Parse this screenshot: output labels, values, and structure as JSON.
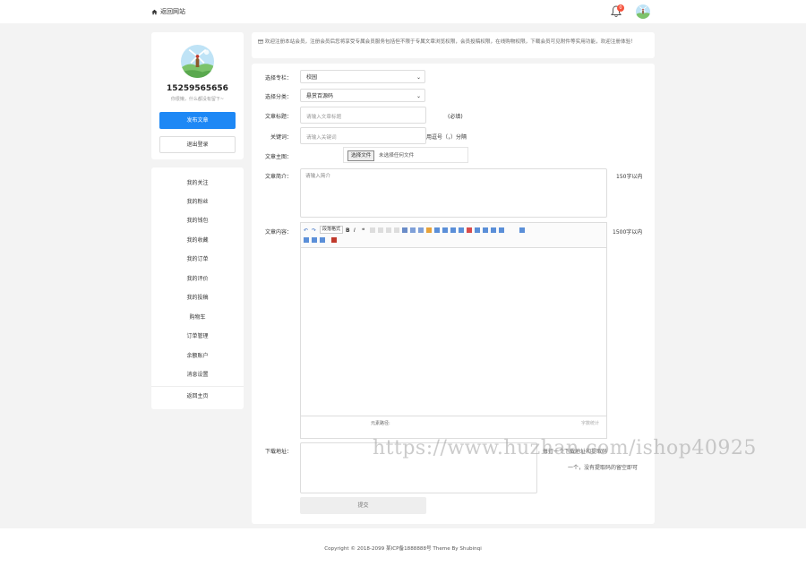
{
  "topbar": {
    "back_label": "返回网站",
    "notification_count": "0"
  },
  "profile": {
    "username": "15259565656",
    "signature": "你很懒，什么都没有留下~",
    "publish_button": "发布文章",
    "logout_button": "退出登录"
  },
  "menu": {
    "items": [
      "我的关注",
      "我的粉丝",
      "我的钱包",
      "我的收藏",
      "我的订单",
      "我的评价",
      "我的投稿",
      "购物车",
      "订单管理",
      "余额账户",
      "消息设置"
    ],
    "back_home": "返回主页"
  },
  "notice": "欢迎注册本站会员，注册会员后您将享受专属会员服务包括但不限于专属文章浏览权限，会员投稿权限，在线购物权限，下载会员可见附件等实用功能，欢迎注册体验！",
  "form": {
    "column_label": "选择专栏：",
    "column_value": "校园",
    "category_label": "选择分类：",
    "category_value": "悬赏百源码",
    "title_label": "文章标题：",
    "title_placeholder": "请输入文章标题",
    "title_hint": "(必填)",
    "keywords_label": "关键词：",
    "keywords_placeholder": "请输入关键词",
    "keywords_hint": "用逗号（，）分隔",
    "cover_label": "文章主图：",
    "file_button": "选择文件",
    "file_status": "未选择任何文件",
    "intro_label": "文章简介：",
    "intro_placeholder": "请输入简介",
    "intro_hint": "150字以内",
    "content_label": "文章内容：",
    "content_hint": "1500字以内",
    "editor_format": "段落格式",
    "editor_element": "元素路径:",
    "editor_wordcount": "字数统计",
    "download_label": "下载地址：",
    "download_hint_1": "每行一个下载地址和提取码",
    "download_hint_2": "一个，没有提取码的留空即可",
    "submit": "提交"
  },
  "footer": "Copyright © 2018-2099  某ICP备1888888号  Theme By Shubinqi",
  "watermark": "https://www.huzhan.com/ishop40925",
  "colors": {
    "primary": "#1e88f5",
    "badge": "#f5533d",
    "background": "#f3f3f3"
  }
}
